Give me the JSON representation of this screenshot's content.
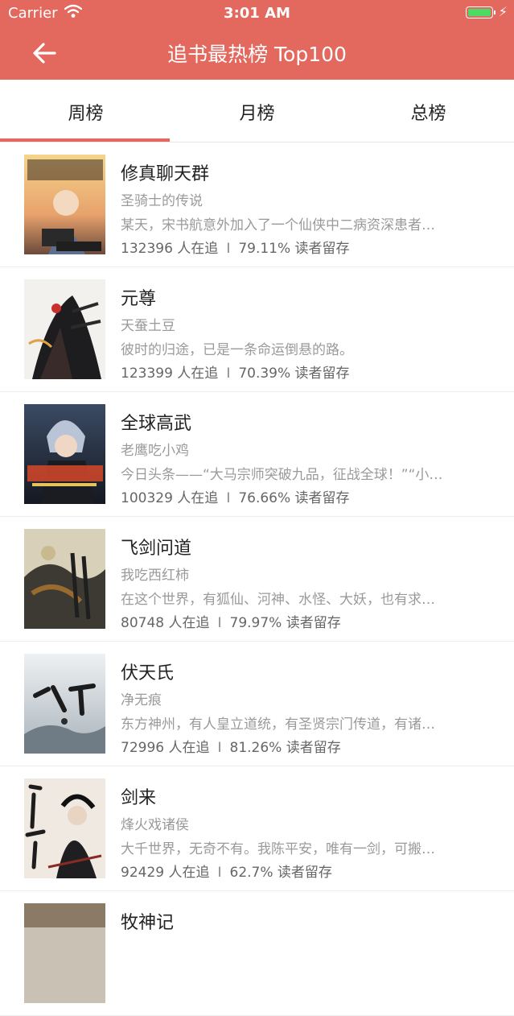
{
  "status_bar": {
    "carrier": "Carrier",
    "time": "3:01 AM"
  },
  "nav": {
    "title": "追书最热榜 Top100"
  },
  "tabs": [
    {
      "label": "周榜",
      "selected": true
    },
    {
      "label": "月榜",
      "selected": false
    },
    {
      "label": "总榜",
      "selected": false
    }
  ],
  "books": [
    {
      "title": "修真聊天群",
      "author": "圣骑士的传说",
      "desc": "某天，宋书航意外加入了一个仙侠中二病资深患者…",
      "followers": "132396 人在追",
      "retention": "79.11% 读者留存"
    },
    {
      "title": "元尊",
      "author": "天蚕土豆",
      "desc": "彼时的归途，已是一条命运倒悬的路。",
      "followers": "123399 人在追",
      "retention": "70.39% 读者留存"
    },
    {
      "title": "全球高武",
      "author": "老鹰吃小鸡",
      "desc": "今日头条——“大马宗师突破九品，征战全球！”“小…",
      "followers": "100329 人在追",
      "retention": "76.66% 读者留存"
    },
    {
      "title": "飞剑问道",
      "author": "我吃西红柿",
      "desc": "在这个世界，有狐仙、河神、水怪、大妖，也有求…",
      "followers": "80748 人在追",
      "retention": "79.97% 读者留存"
    },
    {
      "title": "伏天氏",
      "author": "净无痕",
      "desc": "东方神州，有人皇立道统，有圣贤宗门传道，有诸…",
      "followers": "72996 人在追",
      "retention": "81.26% 读者留存"
    },
    {
      "title": "剑来",
      "author": "烽火戏诸侯",
      "desc": "大千世界，无奇不有。我陈平安，唯有一剑，可搬…",
      "followers": "92429 人在追",
      "retention": "62.7% 读者留存"
    },
    {
      "title": "牧神记",
      "author": "",
      "desc": "",
      "followers": "",
      "retention": ""
    }
  ],
  "colors": {
    "accent": "#e3685e",
    "battery": "#4cd964"
  },
  "icons": {
    "back": "arrow-left-icon",
    "wifi": "wifi-icon",
    "battery": "battery-icon",
    "charging": "bolt-icon"
  }
}
